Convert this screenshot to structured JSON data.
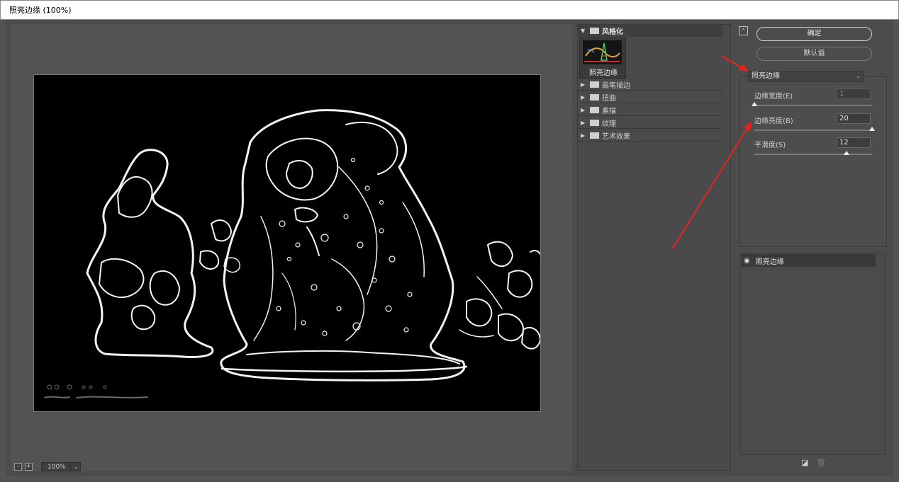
{
  "window": {
    "title": "照亮边缘 (100%)"
  },
  "preview": {
    "zoom": "100%",
    "zoom_out": "-",
    "zoom_in": "+"
  },
  "gallery": {
    "open_folder": "风格化",
    "selected_thumb": "照亮边缘",
    "categories": [
      "画笔描边",
      "扭曲",
      "素描",
      "纹理",
      "艺术效果"
    ]
  },
  "actions": {
    "ok_label": "确定",
    "default_label": "默认值"
  },
  "filter": {
    "selected": "照亮边缘",
    "params": [
      {
        "label": "边缘宽度(E)",
        "value": "1",
        "level": 0.0
      },
      {
        "label": "边缘亮度(B)",
        "value": "20",
        "level": 1.0
      },
      {
        "label": "平滑度(S)",
        "value": "12",
        "level": 0.8
      }
    ]
  },
  "layers": [
    {
      "name": "照亮边缘"
    }
  ],
  "colors": {
    "annotation": "#e8231d",
    "edges": "#ffffff",
    "panel": "#4c4c4c"
  }
}
